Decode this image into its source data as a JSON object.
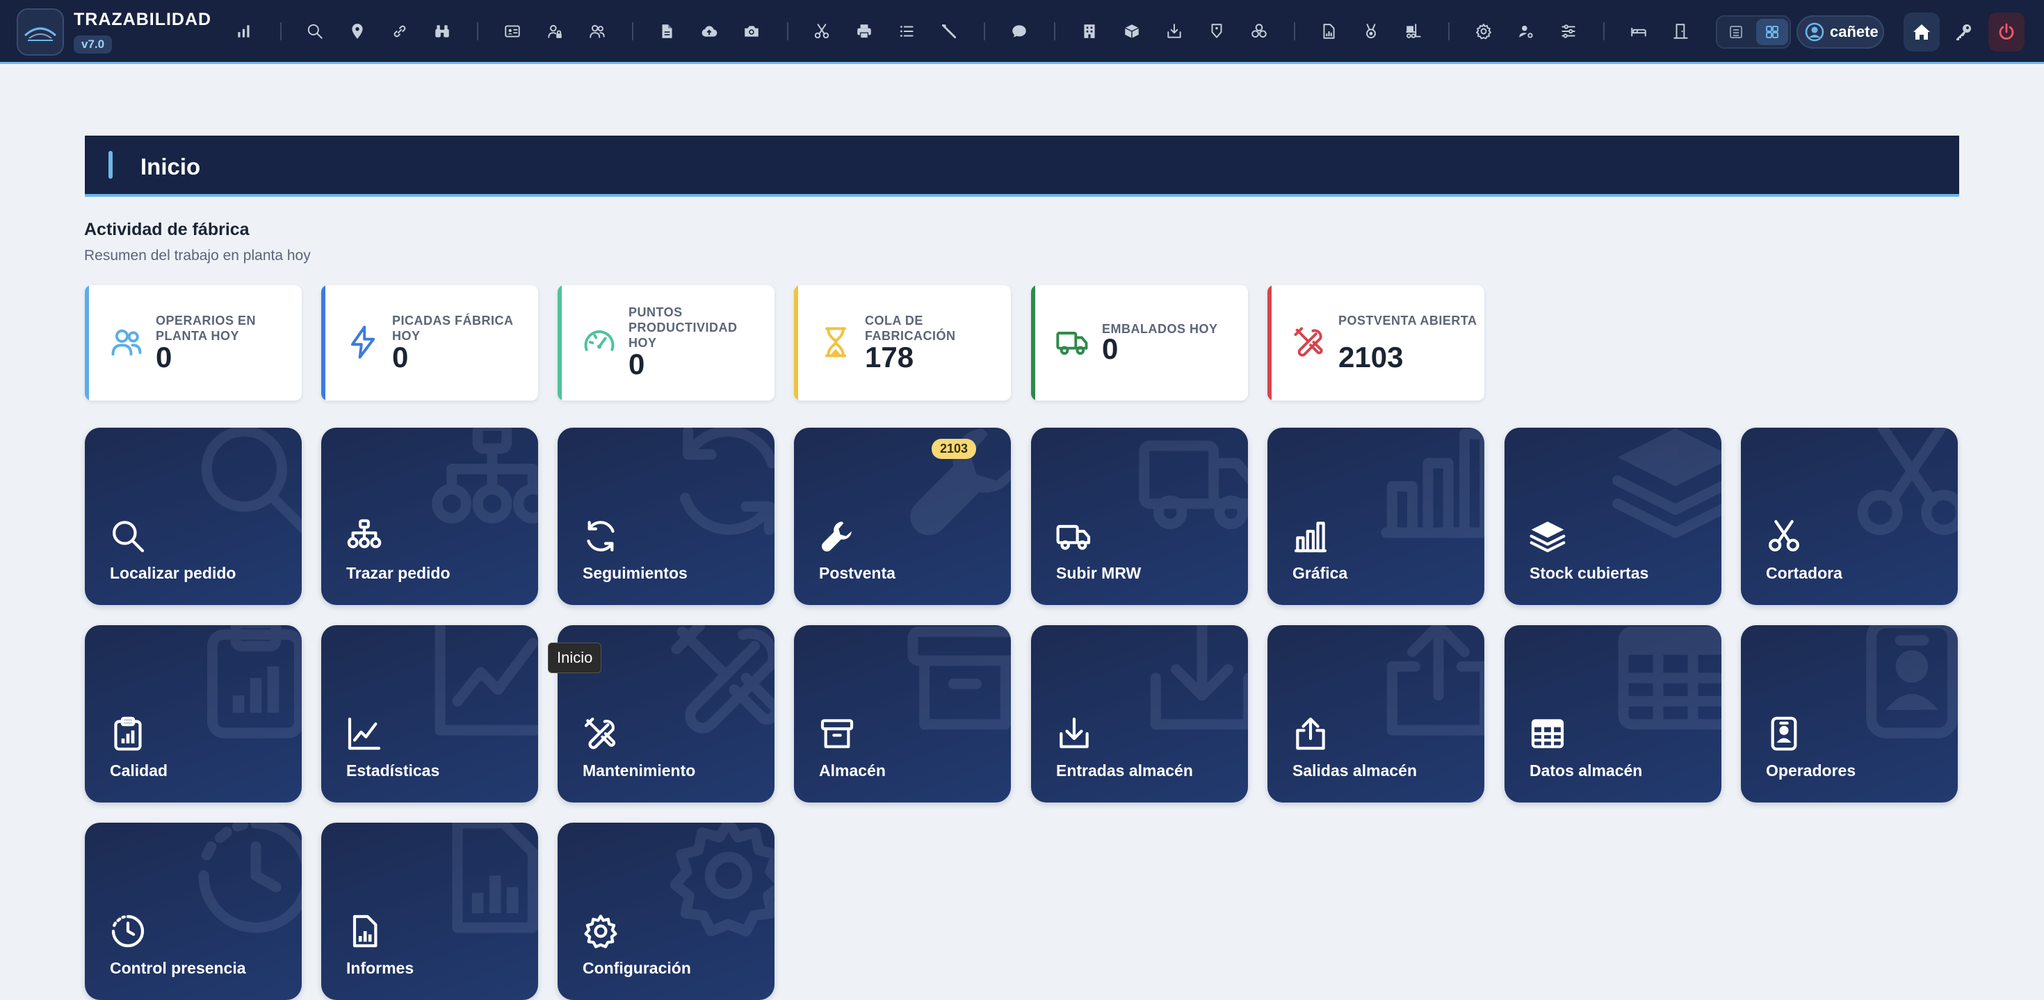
{
  "app": {
    "title": "TRAZABILIDAD",
    "version": "v7.0"
  },
  "toolbar": {
    "icons": [
      "chart-icon",
      "search-icon",
      "location-pin-icon",
      "link-icon",
      "binoculars-icon",
      "id-card-icon",
      "user-lock-icon",
      "users-icon",
      "file-icon",
      "cloud-upload-icon",
      "camera-icon",
      "scissors-icon",
      "printer-icon",
      "list-icon",
      "ruler-icon",
      "chat-icon",
      "building-icon",
      "box-icon",
      "inbox-in-icon",
      "tag-icon",
      "network-icon",
      "report-icon",
      "medal-icon",
      "forklift-icon",
      "gear-icon",
      "user-cog-icon",
      "sliders-icon",
      "bed-icon",
      "door-icon"
    ]
  },
  "user": {
    "name": "cañete"
  },
  "page": {
    "title": "Inicio"
  },
  "section": {
    "title": "Actividad de fábrica",
    "subtitle": "Resumen del trabajo en planta hoy"
  },
  "stats": [
    {
      "label": "OPERARIOS EN PLANTA HOY",
      "value": "0",
      "color": "#5aaee8",
      "icon": "users-icon"
    },
    {
      "label": "PICADAS FÁBRICA HOY",
      "value": "0",
      "color": "#3b7be0",
      "icon": "bolt-icon"
    },
    {
      "label": "PUNTOS PRODUCTIVIDAD HOY",
      "value": "0",
      "color": "#4ec39a",
      "icon": "gauge-icon"
    },
    {
      "label": "COLA DE FABRICACIÓN",
      "value": "178",
      "color": "#f2c23c",
      "icon": "hourglass-icon"
    },
    {
      "label": "EMBALADOS HOY",
      "value": "0",
      "color": "#2e8a4a",
      "icon": "truck-icon"
    },
    {
      "label": "POSTVENTA ABIERTA",
      "value": "2103",
      "color": "#d9424b",
      "icon": "tools-icon"
    }
  ],
  "tiles": [
    {
      "label": "Localizar pedido",
      "icon": "search-icon"
    },
    {
      "label": "Trazar pedido",
      "icon": "sitemap-icon"
    },
    {
      "label": "Seguimientos",
      "icon": "refresh-icon"
    },
    {
      "label": "Postventa",
      "icon": "wrench-icon",
      "badge": "2103"
    },
    {
      "label": "Subir MRW",
      "icon": "truck-icon"
    },
    {
      "label": "Gráfica",
      "icon": "bar-chart-icon"
    },
    {
      "label": "Stock cubiertas",
      "icon": "layers-icon"
    },
    {
      "label": "Cortadora",
      "icon": "scissors-icon"
    },
    {
      "label": "Calidad",
      "icon": "clipboard-chart-icon"
    },
    {
      "label": "Estadísticas",
      "icon": "line-chart-icon"
    },
    {
      "label": "Mantenimiento",
      "icon": "tools-icon"
    },
    {
      "label": "Almacén",
      "icon": "archive-icon"
    },
    {
      "label": "Entradas almacén",
      "icon": "download-icon"
    },
    {
      "label": "Salidas almacén",
      "icon": "upload-icon"
    },
    {
      "label": "Datos almacén",
      "icon": "table-icon"
    },
    {
      "label": "Operadores",
      "icon": "badge-person-icon"
    },
    {
      "label": "Control presencia",
      "icon": "clock-icon"
    },
    {
      "label": "Informes",
      "icon": "report-icon"
    },
    {
      "label": "Configuración",
      "icon": "gear-icon"
    }
  ],
  "tooltip": {
    "text": "Inicio"
  }
}
